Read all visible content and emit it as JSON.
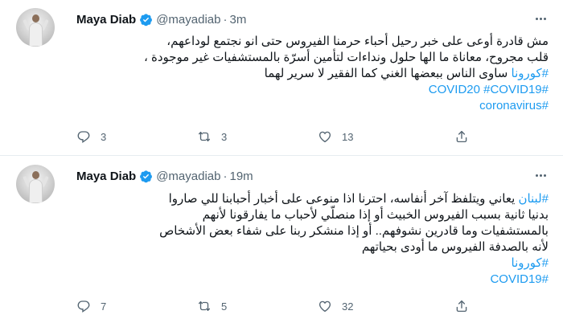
{
  "tweets": [
    {
      "name": "Maya Diab",
      "handle": "@mayadiab",
      "time": "3m",
      "lines": [
        {
          "text": "مش قادرة أوعى على خبر رحيل أحباء حرمنا الفيروس حتى انو نجتمع لوداعهم،"
        },
        {
          "text": "قلب مجروح، معاناة ما الها حلول ونداءات لتأمين  أسرّة بالمستشفيات غير موجودة ،"
        },
        {
          "tag": "#كورونا",
          "text": " ساوى الناس ببعضها الغني كما الفقير لا سرير لهما"
        },
        {
          "tag": "#COVID20 #COVID19"
        },
        {
          "tag": "#coronavirus"
        }
      ],
      "replies": "3",
      "retweets": "3",
      "likes": "13"
    },
    {
      "name": "Maya Diab",
      "handle": "@mayadiab",
      "time": "19m",
      "lines": [
        {
          "tag": "#لبنان",
          "text": " يعاني ويتلفظ آخر أنفاسه، احترنا اذا منوعى على أخبار أحبابنا للي صاروا"
        },
        {
          "text": "بدنيا ثانية بسبب الفيروس الخبيث أو إذا منصلّي لأحباب ما يفارقونا لأنهم"
        },
        {
          "text": "بالمستشفيات وما قادرين نشوفهم.. أو إذا منشكر ربنا على شفاء بعض الأشخاص"
        },
        {
          "text": "لأنه بالصدفة الفيروس ما أودى بحياتهم"
        },
        {
          "tag": "#كورونا"
        },
        {
          "tag": "#COVID19"
        }
      ],
      "replies": "7",
      "retweets": "5",
      "likes": "32"
    }
  ],
  "icons": {
    "verified": "verified-badge-icon",
    "more": "more-options-icon",
    "reply": "reply-icon",
    "retweet": "retweet-icon",
    "like": "like-icon",
    "share": "share-icon"
  },
  "colors": {
    "accent": "#1d9bf0",
    "text": "#0f1419",
    "secondary": "#536471",
    "divider": "#e6ecf0"
  }
}
